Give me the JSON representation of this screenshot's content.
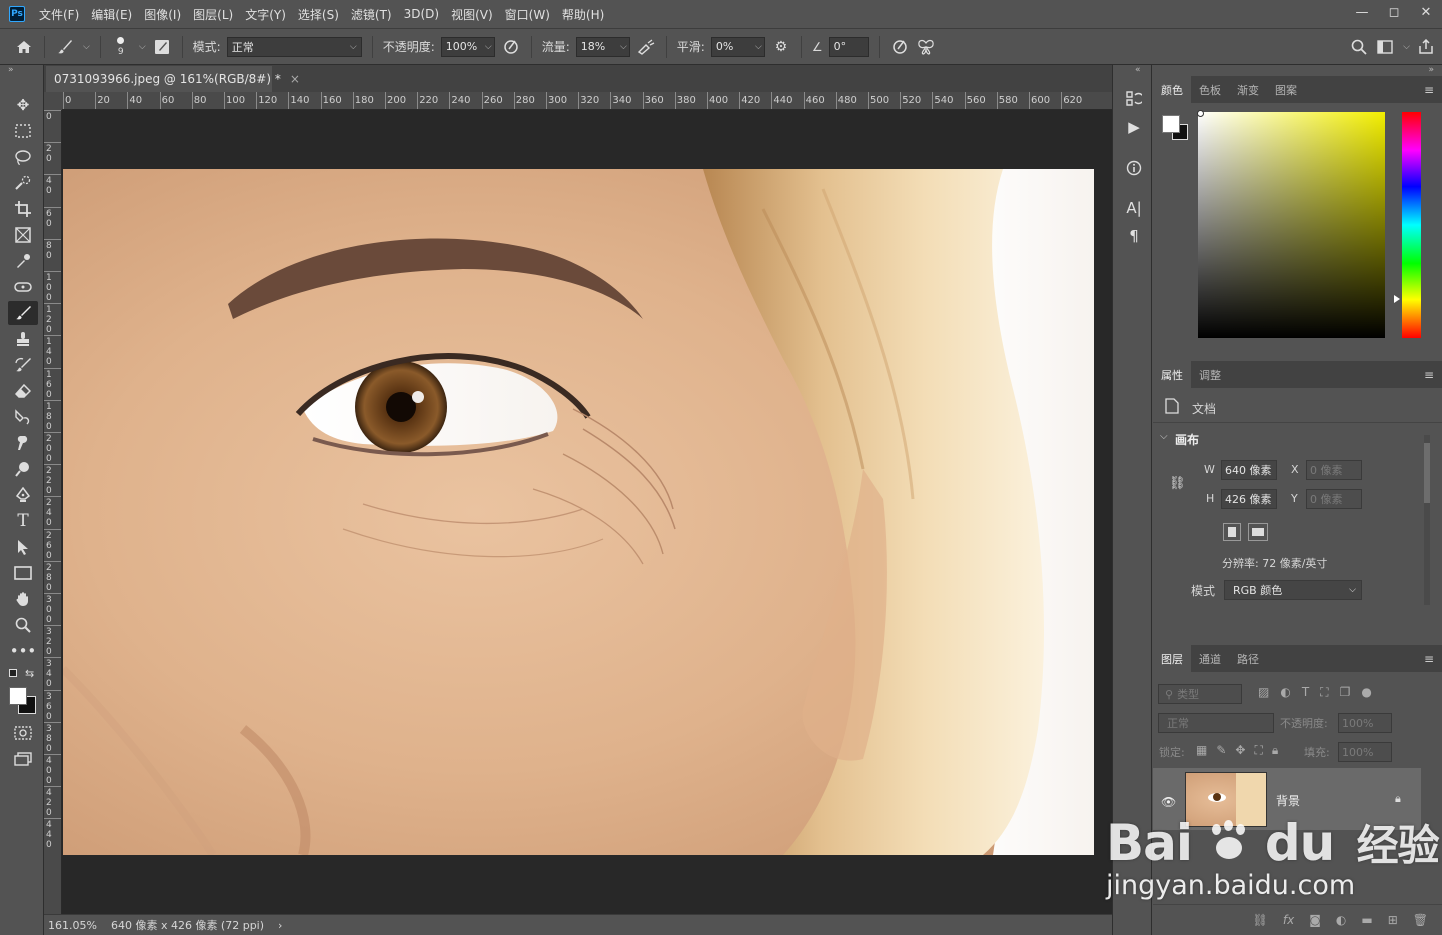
{
  "app": {
    "logo": "Ps"
  },
  "menu": [
    "文件(F)",
    "编辑(E)",
    "图像(I)",
    "图层(L)",
    "文字(Y)",
    "选择(S)",
    "滤镜(T)",
    "3D(D)",
    "视图(V)",
    "窗口(W)",
    "帮助(H)"
  ],
  "window_controls": {
    "minimize": "—",
    "restore": "◻",
    "close": "✕"
  },
  "options": {
    "brush_size": "9",
    "mode_label": "模式:",
    "mode_value": "正常",
    "opacity_label": "不透明度:",
    "opacity_value": "100%",
    "flow_label": "流量:",
    "flow_value": "18%",
    "smooth_label": "平滑:",
    "smooth_value": "0%",
    "angle_value": "0°"
  },
  "document": {
    "tab_title": "0731093966.jpeg @ 161%(RGB/8#) *",
    "tab_close": "×",
    "ruler_h": [
      "0",
      "20",
      "40",
      "60",
      "80",
      "100",
      "120",
      "140",
      "160",
      "180",
      "200",
      "220",
      "240",
      "260",
      "280",
      "300",
      "320",
      "340",
      "360",
      "380",
      "400",
      "420",
      "440",
      "460",
      "480",
      "500",
      "520",
      "540",
      "560",
      "580",
      "600",
      "620"
    ],
    "ruler_v": [
      "0",
      "20",
      "40",
      "60",
      "80",
      "100",
      "120",
      "140",
      "160",
      "180",
      "200",
      "220",
      "240",
      "260",
      "280",
      "300",
      "320",
      "340",
      "360",
      "380",
      "400",
      "420",
      "440"
    ]
  },
  "status": {
    "zoom": "161.05%",
    "info": "640 像素 x 426 像素 (72 ppi)",
    "arrow": "›"
  },
  "color_panel": {
    "tabs": [
      "颜色",
      "色板",
      "渐变",
      "图案"
    ],
    "active": 0
  },
  "properties_panel": {
    "tabs": [
      "属性",
      "调整"
    ],
    "doc_label": "文档",
    "section": "画布",
    "w_label": "W",
    "w_value": "640 像素",
    "h_label": "H",
    "h_value": "426 像素",
    "x_label": "X",
    "x_value": "0 像素",
    "y_label": "Y",
    "y_value": "0 像素",
    "resolution": "分辨率: 72 像素/英寸",
    "mode_label": "模式",
    "mode_value": "RGB 颜色"
  },
  "layers_panel": {
    "tabs": [
      "图层",
      "通道",
      "路径"
    ],
    "filter_placeholder": "类型",
    "blend_value": "正常",
    "opacity_label": "不透明度:",
    "opacity_value": "100%",
    "lock_label": "锁定:",
    "fill_label": "填充:",
    "fill_value": "100%",
    "layer_name": "背景"
  },
  "watermark": {
    "brand": "Bai",
    "brand2": "du",
    "cn": "经验",
    "url": "jingyan.baidu.com"
  },
  "colors": {
    "bg": "#535353",
    "panel_dark": "#424242",
    "canvas": "#282828",
    "skin": "#ddb08a"
  }
}
